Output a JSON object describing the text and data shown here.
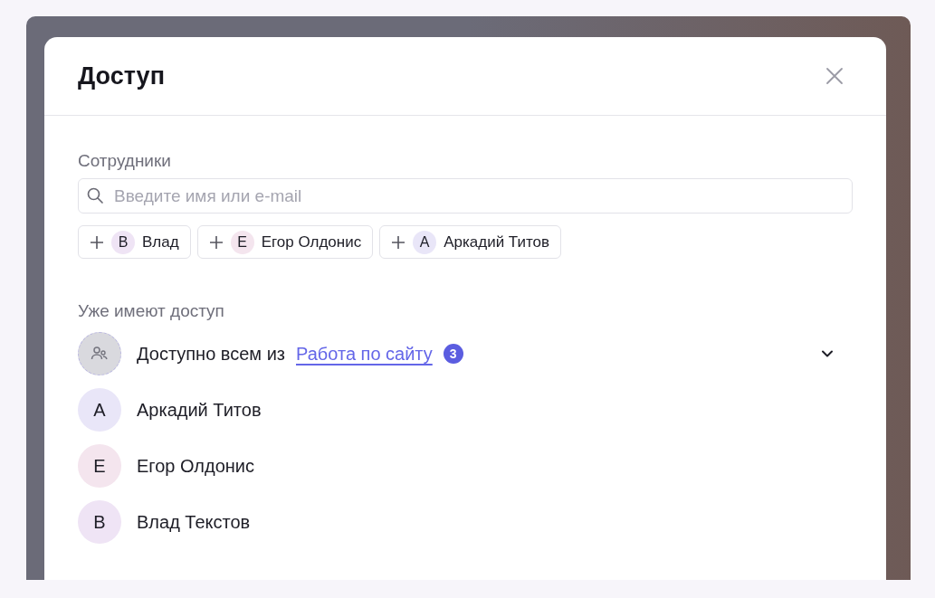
{
  "dialog": {
    "title": "Доступ"
  },
  "employees": {
    "label": "Сотрудники",
    "search": {
      "placeholder": "Введите имя или e-mail"
    },
    "suggestions": [
      {
        "initial": "В",
        "name": "Влад",
        "color": "#efe4f5"
      },
      {
        "initial": "Е",
        "name": "Егор Олдонис",
        "color": "#f4e5ee"
      },
      {
        "initial": "А",
        "name": "Аркадий Титов",
        "color": "#e9e6f8"
      }
    ]
  },
  "access": {
    "label": "Уже имеют доступ",
    "group": {
      "prefix": "Доступно всем из",
      "link": "Работа по сайту",
      "count": "3",
      "expanded": false
    },
    "members": [
      {
        "initial": "А",
        "name": "Аркадий Титов",
        "color": "#e9e6f8"
      },
      {
        "initial": "Е",
        "name": "Егор Олдонис",
        "color": "#f4e5ee"
      },
      {
        "initial": "В",
        "name": "Влад Текстов",
        "color": "#efe4f5"
      }
    ]
  }
}
